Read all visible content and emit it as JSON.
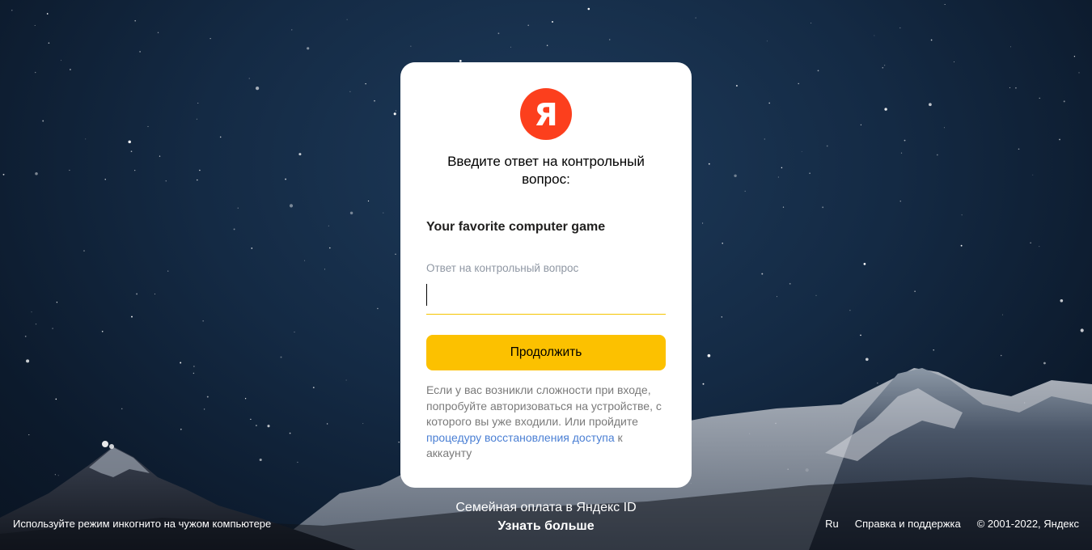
{
  "card": {
    "logo_letter": "Я",
    "title": "Введите ответ на контрольный вопрос:",
    "question": "Your favorite computer game",
    "answer_label": "Ответ на контрольный вопрос",
    "answer_value": "",
    "continue_button": "Продолжить",
    "help_text_before": "Если у вас возникли сложности при входе, попробуйте авторизоваться на устройстве, с которого вы уже входили. Или пройдите ",
    "help_link": "процедуру восстановления доступа",
    "help_text_after": " к аккаунту"
  },
  "promo": {
    "text": "Семейная оплата в Яндекс ID",
    "link": "Узнать больше"
  },
  "footer": {
    "incognito_hint": "Используйте режим инкогнито на чужом компьютере",
    "language": "Ru",
    "support": "Справка и поддержка",
    "copyright": "© 2001-2022, Яндекс"
  },
  "colors": {
    "brand_red": "#fc3f1d",
    "button_yellow": "#fcc100",
    "link_blue": "#4a7fd4"
  }
}
